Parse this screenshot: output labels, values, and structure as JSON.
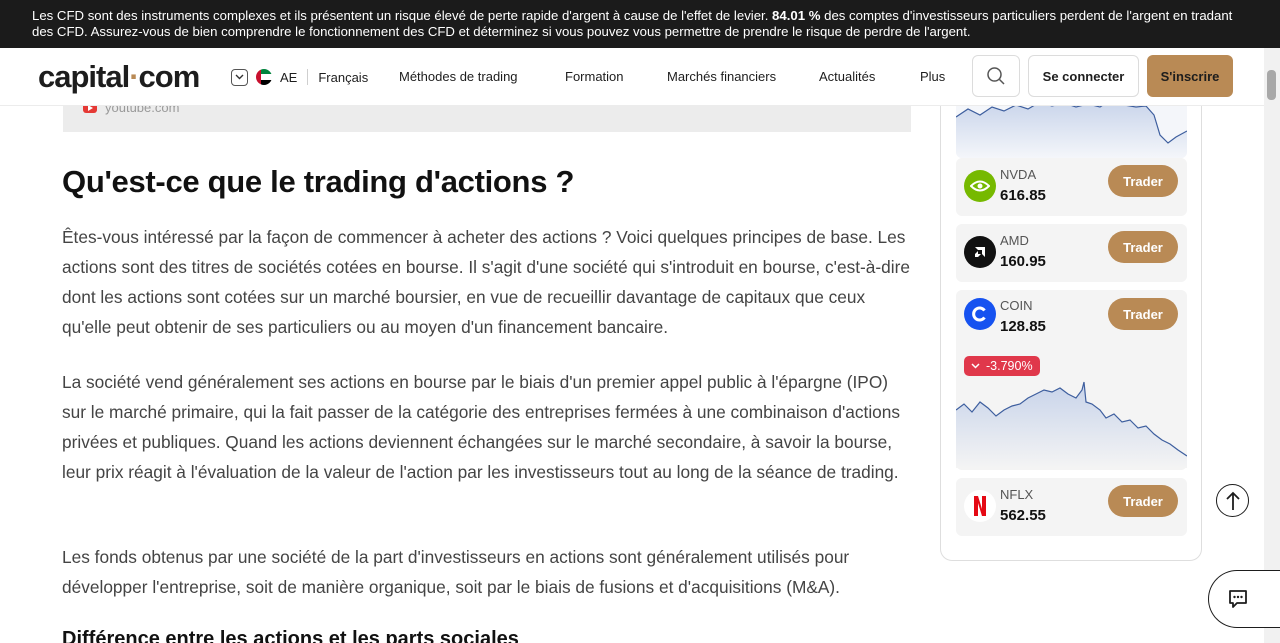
{
  "risk_banner": {
    "before": "Les CFD sont des instruments complexes et ils présentent un risque élevé de perte rapide d'argent à cause de l'effet de levier. ",
    "percent": "84.01 %",
    "after": " des comptes d'investisseurs particuliers perdent de l'argent en tradant des CFD. Assurez-vous de bien comprendre le fonctionnement des CFD et déterminez si vous pouvez vous permettre de prendre le risque de perdre de l'argent."
  },
  "header": {
    "logo_left": "capital",
    "logo_dot": "·",
    "logo_right": "com",
    "region_code": "AE",
    "language": "Français",
    "nav": [
      "Méthodes de trading",
      "Formation",
      "Marchés financiers",
      "Actualités",
      "Plus"
    ],
    "login_label": "Se connecter",
    "signup_label": "S'inscrire"
  },
  "video": {
    "source": "youtube.com"
  },
  "article": {
    "title": "Qu'est-ce que le trading d'actions ?",
    "paragraphs": [
      "Êtes-vous intéressé par la façon de commencer à acheter des actions ? Voici quelques principes de base. Les actions sont des titres de sociétés cotées en bourse. Il s'agit d'une société qui s'introduit en bourse, c'est-à-dire dont les actions sont cotées sur un marché boursier, en vue de recueillir davantage de capitaux que ceux qu'elle peut obtenir de ses particuliers ou au moyen d'un financement bancaire.",
      "La société vend généralement ses actions en bourse par le biais d'un premier appel public à l'épargne (IPO) sur le marché primaire, qui la fait passer de la catégorie des entreprises fermées à une combinaison d'actions privées et publiques. Quand les actions deviennent échangées sur le marché secondaire, à savoir la bourse, leur prix réagit à l'évaluation de la valeur de l'action par les investisseurs tout au long de la séance de trading.",
      "Les fonds obtenus par une société de la part d'investisseurs en actions sont généralement utilisés pour développer l'entreprise, soit de manière organique, soit par le biais de fusions et d'acquisitions (M&A)."
    ],
    "next_heading": "Différence entre les actions et les parts sociales"
  },
  "sidebar": {
    "trade_label": "Trader",
    "tickers": [
      {
        "symbol": "NVDA",
        "price": "616.85"
      },
      {
        "symbol": "AMD",
        "price": "160.95"
      },
      {
        "symbol": "COIN",
        "price": "128.85",
        "change": "-3.790%"
      },
      {
        "symbol": "NFLX",
        "price": "562.55"
      }
    ]
  },
  "colors": {
    "accent": "#b98a55",
    "negative": "#e0384b",
    "banner_bg": "#1b1b1b"
  }
}
